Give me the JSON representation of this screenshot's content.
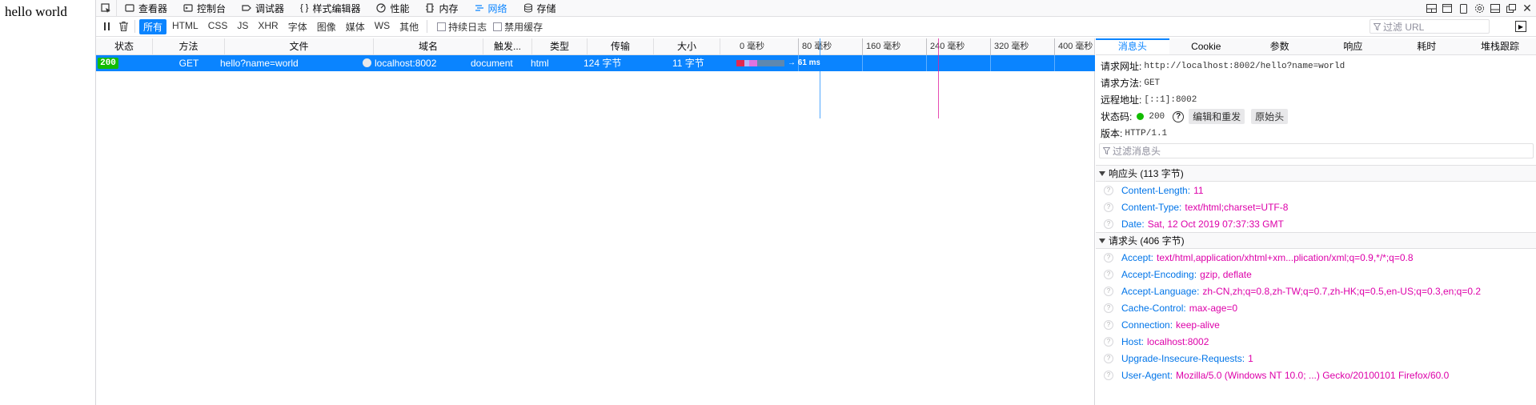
{
  "page": {
    "text": "hello world"
  },
  "devtools": {
    "tabs": [
      {
        "label": "查看器",
        "icon": "inspector-icon"
      },
      {
        "label": "控制台",
        "icon": "console-icon"
      },
      {
        "label": "调试器",
        "icon": "debugger-icon"
      },
      {
        "label": "样式编辑器",
        "icon": "style-editor-icon"
      },
      {
        "label": "性能",
        "icon": "performance-icon"
      },
      {
        "label": "内存",
        "icon": "memory-icon"
      },
      {
        "label": "网络",
        "icon": "network-icon"
      },
      {
        "label": "存储",
        "icon": "storage-icon"
      }
    ],
    "active_tab": "网络"
  },
  "toolbar": {
    "filters": [
      "所有",
      "HTML",
      "CSS",
      "JS",
      "XHR",
      "字体",
      "图像",
      "媒体",
      "WS",
      "其他"
    ],
    "active_filter": "所有",
    "persist_logs": "持续日志",
    "disable_cache": "禁用缓存",
    "url_filter_placeholder": "过滤 URL"
  },
  "columns": [
    "状态",
    "方法",
    "文件",
    "域名",
    "触发...",
    "类型",
    "传输",
    "大小"
  ],
  "timeline_ticks": [
    "0 毫秒",
    "80 毫秒",
    "160 毫秒",
    "240 毫秒",
    "320 毫秒",
    "400 毫秒"
  ],
  "request": {
    "status": "200",
    "method": "GET",
    "file": "hello?name=world",
    "domain": "localhost:8002",
    "cause": "document",
    "type": "html",
    "transferred": "124 字节",
    "size": "11 字节",
    "timing": "→ 61 ms"
  },
  "details": {
    "tabs": [
      "消息头",
      "Cookie",
      "参数",
      "响应",
      "耗时",
      "堆栈跟踪"
    ],
    "active_tab": "消息头",
    "summary": {
      "url_label": "请求网址:",
      "url": "http://localhost:8002/hello?name=world",
      "method_label": "请求方法:",
      "method": "GET",
      "remote_label": "远程地址:",
      "remote": "[::1]:8002",
      "status_label": "状态码:",
      "status": "200",
      "edit_resend": "编辑和重发",
      "raw_headers": "原始头",
      "version_label": "版本:",
      "version": "HTTP/1.1"
    },
    "header_filter_placeholder": "过滤消息头",
    "response_headers": {
      "title": "响应头 (113 字节)",
      "items": [
        {
          "name": "Content-Length:",
          "value": "11"
        },
        {
          "name": "Content-Type:",
          "value": "text/html;charset=UTF-8"
        },
        {
          "name": "Date:",
          "value": "Sat, 12 Oct 2019 07:37:33 GMT"
        }
      ]
    },
    "request_headers": {
      "title": "请求头 (406 字节)",
      "items": [
        {
          "name": "Accept:",
          "value": "text/html,application/xhtml+xm...plication/xml;q=0.9,*/*;q=0.8"
        },
        {
          "name": "Accept-Encoding:",
          "value": "gzip, deflate"
        },
        {
          "name": "Accept-Language:",
          "value": "zh-CN,zh;q=0.8,zh-TW;q=0.7,zh-HK;q=0.5,en-US;q=0.3,en;q=0.2"
        },
        {
          "name": "Cache-Control:",
          "value": "max-age=0"
        },
        {
          "name": "Connection:",
          "value": "keep-alive"
        },
        {
          "name": "Host:",
          "value": "localhost:8002"
        },
        {
          "name": "Upgrade-Insecure-Requests:",
          "value": "1"
        },
        {
          "name": "User-Agent:",
          "value": "Mozilla/5.0 (Windows NT 10.0; ...) Gecko/20100101 Firefox/60.0"
        }
      ]
    }
  },
  "colors": {
    "accent": "#0a84ff",
    "status_ok": "#12bc00",
    "header_name": "#0074e8",
    "header_value": "#dd00a9"
  }
}
